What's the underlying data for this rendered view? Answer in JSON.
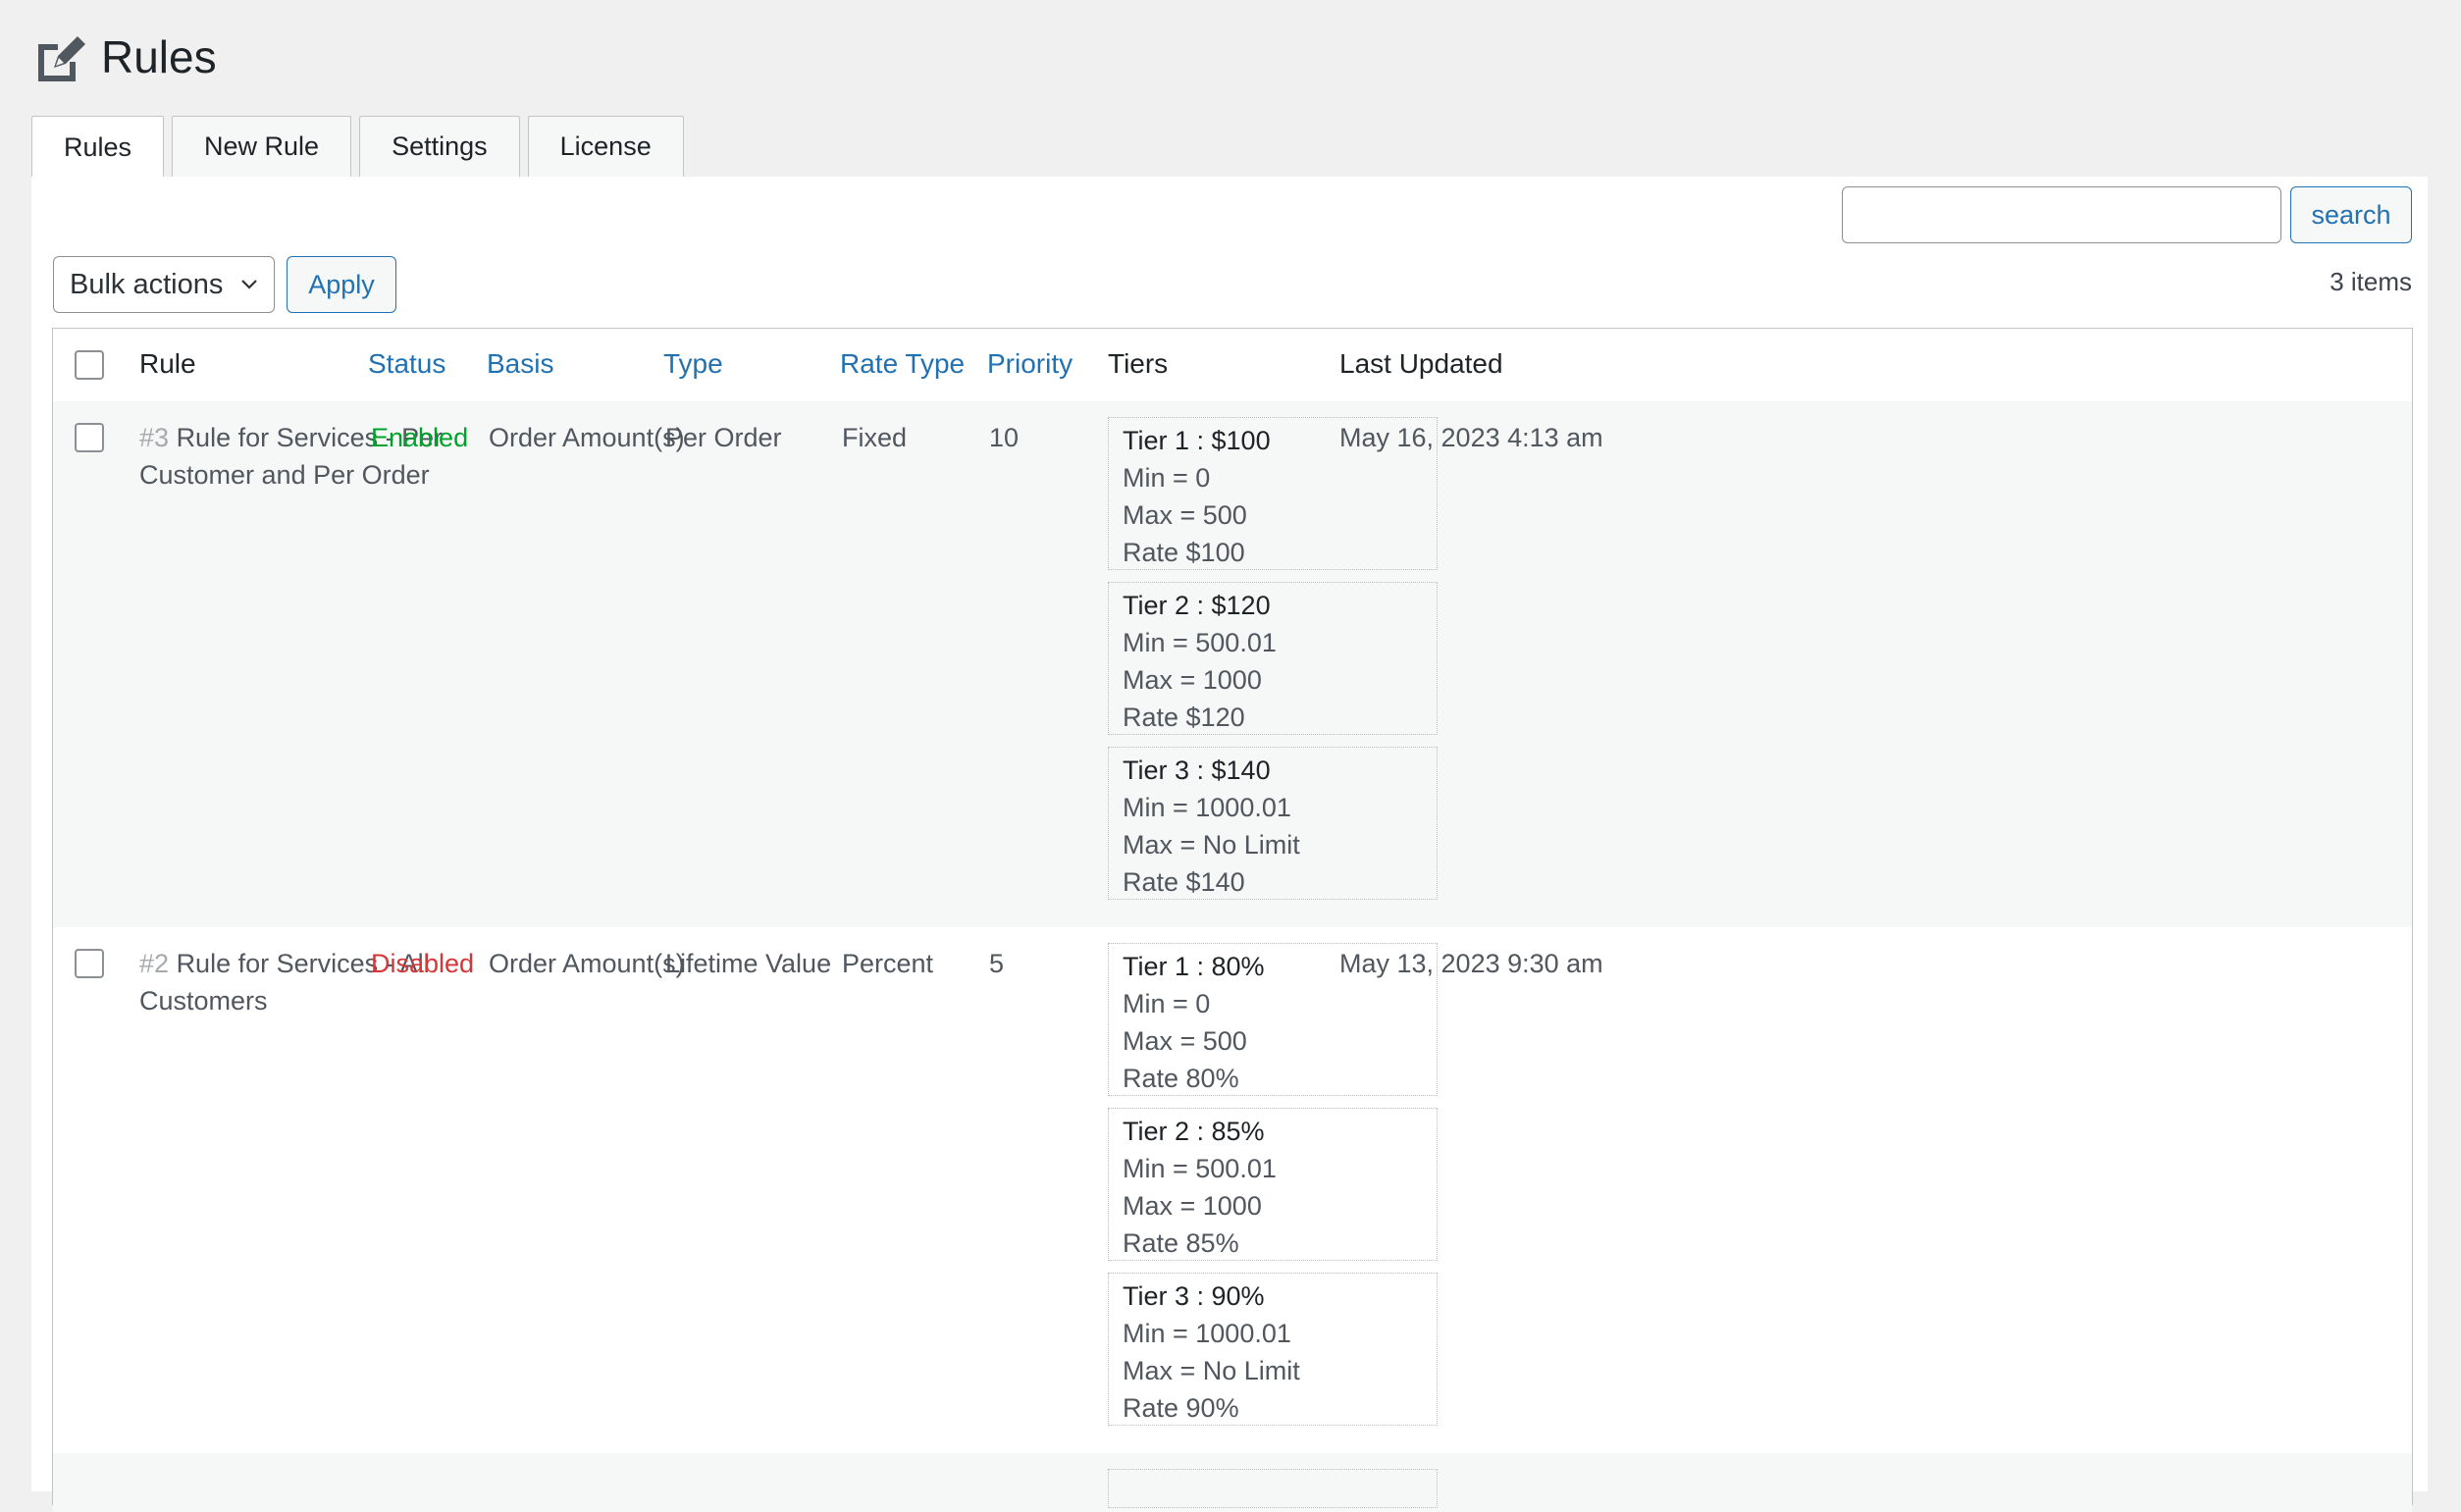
{
  "page": {
    "title": "Rules",
    "icon": "edit-page-icon"
  },
  "tabs": [
    {
      "label": "Rules",
      "active": true
    },
    {
      "label": "New Rule",
      "active": false
    },
    {
      "label": "Settings",
      "active": false
    },
    {
      "label": "License",
      "active": false
    }
  ],
  "search": {
    "value": "",
    "placeholder": "",
    "button_label": "search"
  },
  "bulk_actions": {
    "selected": "Bulk actions",
    "apply_label": "Apply"
  },
  "items_count": "3 items",
  "table": {
    "columns": [
      "Rule",
      "Status",
      "Basis",
      "Type",
      "Rate Type",
      "Priority",
      "Tiers",
      "Last Updated"
    ],
    "rows": [
      {
        "id": "#3",
        "name": "Rule for Services - Per Customer and Per Order",
        "status": "Enabled",
        "basis": "Order Amount(s)",
        "type": "Per Order",
        "rate_type": "Fixed",
        "priority": "10",
        "last_updated": "May 16, 2023 4:13 am",
        "tiers": [
          {
            "title": "Tier 1 : $100",
            "min": "Min = 0",
            "max": "Max = 500",
            "rate": "Rate $100"
          },
          {
            "title": "Tier 2 : $120",
            "min": "Min = 500.01",
            "max": "Max = 1000",
            "rate": "Rate $120"
          },
          {
            "title": "Tier 3 : $140",
            "min": "Min = 1000.01",
            "max": "Max = No Limit",
            "rate": "Rate $140"
          }
        ]
      },
      {
        "id": "#2",
        "name": "Rule for Services - All Customers",
        "status": "Disabled",
        "basis": "Order Amount(s)",
        "type": "Lifetime Value",
        "rate_type": "Percent",
        "priority": "5",
        "last_updated": "May 13, 2023 9:30 am",
        "tiers": [
          {
            "title": "Tier 1 : 80%",
            "min": "Min = 0",
            "max": "Max = 500",
            "rate": "Rate 80%"
          },
          {
            "title": "Tier 2 : 85%",
            "min": "Min = 500.01",
            "max": "Max = 1000",
            "rate": "Rate 85%"
          },
          {
            "title": "Tier 3 : 90%",
            "min": "Min = 1000.01",
            "max": "Max = No Limit",
            "rate": "Rate 90%"
          }
        ]
      }
    ]
  },
  "colors": {
    "link": "#2271b1",
    "enabled": "#00a32a",
    "disabled": "#d63638"
  }
}
